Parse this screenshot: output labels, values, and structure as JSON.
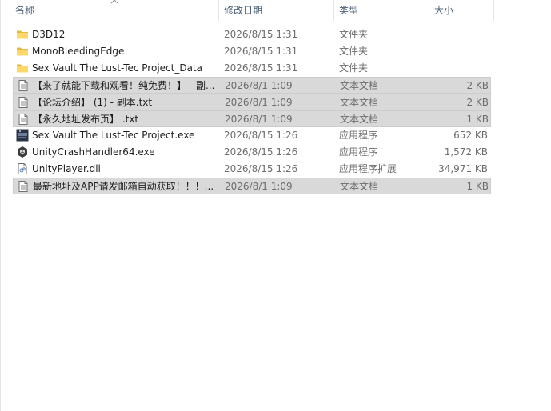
{
  "columns": {
    "name": "名称",
    "date": "修改日期",
    "type": "类型",
    "size": "大小"
  },
  "files": [
    {
      "name": "D3D12",
      "date": "2026/8/15 1:31",
      "type": "文件夹",
      "size": "",
      "icon": "folder-icon",
      "selected": false
    },
    {
      "name": "MonoBleedingEdge",
      "date": "2026/8/15 1:31",
      "type": "文件夹",
      "size": "",
      "icon": "folder-icon",
      "selected": false
    },
    {
      "name": "Sex Vault The Lust-Tec Project_Data",
      "date": "2026/8/15 1:31",
      "type": "文件夹",
      "size": "",
      "icon": "folder-icon",
      "selected": false
    },
    {
      "name": "【来了就能下载和观看！纯免费！】 - 副...",
      "date": "2026/8/1 1:09",
      "type": "文本文档",
      "size": "2 KB",
      "icon": "text-file-icon",
      "selected": true
    },
    {
      "name": "【论坛介绍】 (1) - 副本.txt",
      "date": "2026/8/1 1:09",
      "type": "文本文档",
      "size": "2 KB",
      "icon": "text-file-icon",
      "selected": true
    },
    {
      "name": "【永久地址发布页】 .txt",
      "date": "2026/8/1 1:09",
      "type": "文本文档",
      "size": "1 KB",
      "icon": "text-file-icon",
      "selected": true
    },
    {
      "name": "Sex Vault The Lust-Tec Project.exe",
      "date": "2026/8/15 1:26",
      "type": "应用程序",
      "size": "652 KB",
      "icon": "game-exe-icon",
      "selected": false
    },
    {
      "name": "UnityCrashHandler64.exe",
      "date": "2026/8/15 1:26",
      "type": "应用程序",
      "size": "1,572 KB",
      "icon": "unity-icon",
      "selected": false
    },
    {
      "name": "UnityPlayer.dll",
      "date": "2026/8/15 1:26",
      "type": "应用程序扩展",
      "size": "34,971 KB",
      "icon": "dll-file-icon",
      "selected": false
    },
    {
      "name": "最新地址及APP请发邮箱自动获取！！！...",
      "date": "2026/8/1 1:09",
      "type": "文本文档",
      "size": "1 KB",
      "icon": "text-file-icon",
      "selected": true
    }
  ]
}
